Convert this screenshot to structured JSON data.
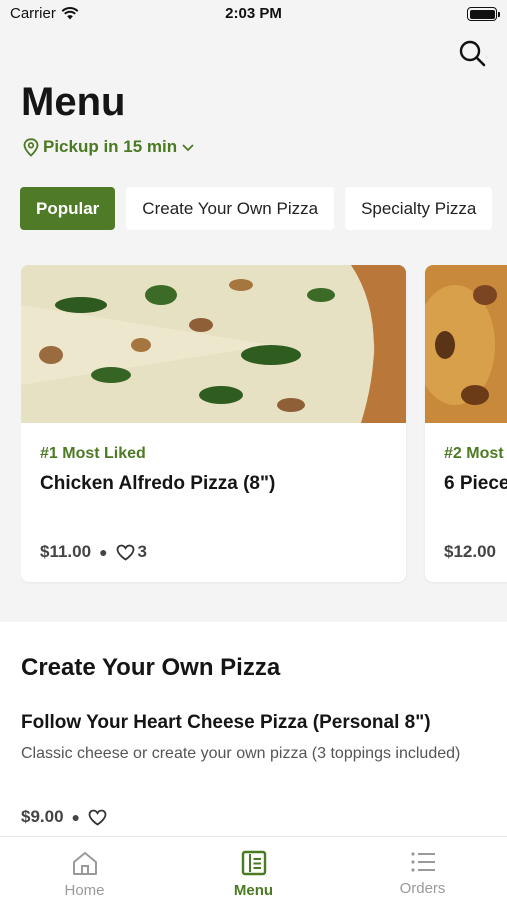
{
  "status_bar": {
    "carrier": "Carrier",
    "time": "2:03 PM"
  },
  "header": {
    "title": "Menu",
    "pickup": "Pickup in 15 min"
  },
  "categories": [
    "Popular",
    "Create Your Own Pizza",
    "Specialty Pizza"
  ],
  "popular_items": [
    {
      "badge": "#1 Most Liked",
      "name": "Chicken Alfredo Pizza (8\")",
      "price": "$11.00",
      "likes": "3"
    },
    {
      "badge": "#2 Most",
      "name": "6 Piece",
      "price": "$12.00"
    }
  ],
  "section": {
    "title": "Create Your Own Pizza",
    "item": {
      "name": "Follow Your Heart Cheese Pizza (Personal 8\")",
      "description": "Classic cheese or create your own pizza (3 toppings included)",
      "price": "$9.00"
    }
  },
  "tabs": [
    {
      "label": "Home",
      "icon": "home-icon"
    },
    {
      "label": "Menu",
      "icon": "menu-book-icon",
      "active": true
    },
    {
      "label": "Orders",
      "icon": "list-icon"
    }
  ],
  "colors": {
    "accent": "#4f7a28",
    "background": "#f4f4f4"
  }
}
